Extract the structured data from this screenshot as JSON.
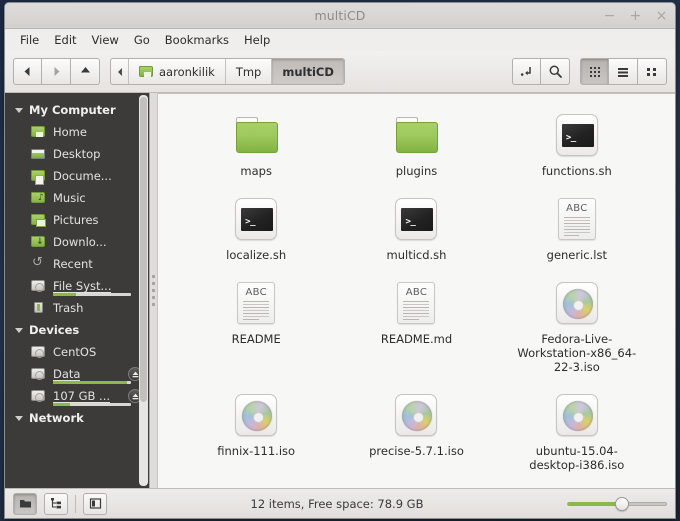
{
  "window": {
    "title": "multiCD",
    "controls": {
      "minimize": "−",
      "maximize": "+",
      "close": "×"
    }
  },
  "menubar": {
    "items": [
      {
        "label": "File"
      },
      {
        "label": "Edit"
      },
      {
        "label": "View"
      },
      {
        "label": "Go"
      },
      {
        "label": "Bookmarks"
      },
      {
        "label": "Help"
      }
    ]
  },
  "toolbar": {
    "nav": [
      {
        "name": "back-button",
        "icon": "arrow-left-icon",
        "enabled": true
      },
      {
        "name": "forward-button",
        "icon": "arrow-right-icon",
        "enabled": false
      },
      {
        "name": "up-button",
        "icon": "arrow-up-icon",
        "enabled": true
      }
    ],
    "breadcrumbs": [
      {
        "label": "aaronkilik",
        "icon": "home-folder-icon",
        "active": false
      },
      {
        "label": "Tmp",
        "icon": "",
        "active": false
      },
      {
        "label": "multiCD",
        "icon": "",
        "active": true
      }
    ],
    "actions": [
      {
        "name": "show-hidden-button",
        "icon": "path-entry-icon"
      },
      {
        "name": "search-button",
        "icon": "search-icon"
      }
    ],
    "view_modes": [
      {
        "name": "icon-view-button",
        "icon": "grid-icon",
        "active": true
      },
      {
        "name": "list-view-button",
        "icon": "list-icon",
        "active": false
      },
      {
        "name": "compact-view-button",
        "icon": "compact-icon",
        "active": false
      }
    ]
  },
  "sidebar": {
    "groups": [
      {
        "label": "My Computer",
        "items": [
          {
            "label": "Home",
            "icon": "home-folder-icon",
            "usage": null,
            "eject": false,
            "underline": false
          },
          {
            "label": "Desktop",
            "icon": "desktop-folder-icon",
            "usage": null,
            "eject": false,
            "underline": false
          },
          {
            "label": "Docume...",
            "icon": "documents-folder-icon",
            "usage": null,
            "eject": false,
            "underline": false
          },
          {
            "label": "Music",
            "icon": "music-folder-icon",
            "usage": null,
            "eject": false,
            "underline": false
          },
          {
            "label": "Pictures",
            "icon": "pictures-folder-icon",
            "usage": null,
            "eject": false,
            "underline": false
          },
          {
            "label": "Downlo...",
            "icon": "downloads-folder-icon",
            "usage": null,
            "eject": false,
            "underline": false
          },
          {
            "label": "Recent",
            "icon": "recent-icon",
            "usage": null,
            "eject": false,
            "underline": false
          },
          {
            "label": "File Syst...",
            "icon": "drive-icon",
            "usage": 30,
            "eject": false,
            "underline": true
          },
          {
            "label": "Trash",
            "icon": "trash-icon",
            "usage": null,
            "eject": false,
            "underline": false
          }
        ]
      },
      {
        "label": "Devices",
        "items": [
          {
            "label": "CentOS",
            "icon": "drive-icon",
            "usage": null,
            "eject": false,
            "underline": false
          },
          {
            "label": "Data",
            "icon": "drive-icon",
            "usage": 95,
            "eject": true,
            "underline": true
          },
          {
            "label": "107 GB ...",
            "icon": "drive-icon",
            "usage": 22,
            "eject": true,
            "underline": true
          }
        ]
      },
      {
        "label": "Network",
        "items": []
      }
    ]
  },
  "content": {
    "files": [
      {
        "name": "maps",
        "type": "folder"
      },
      {
        "name": "plugins",
        "type": "folder"
      },
      {
        "name": "functions.sh",
        "type": "script"
      },
      {
        "name": "localize.sh",
        "type": "script"
      },
      {
        "name": "multicd.sh",
        "type": "script"
      },
      {
        "name": "generic.lst",
        "type": "text"
      },
      {
        "name": "README",
        "type": "text"
      },
      {
        "name": "README.md",
        "type": "text"
      },
      {
        "name": "Fedora-Live-Workstation-x86_64-22-3.iso",
        "type": "iso"
      },
      {
        "name": "finnix-111.iso",
        "type": "iso"
      },
      {
        "name": "precise-5.7.1.iso",
        "type": "iso"
      },
      {
        "name": "ubuntu-15.04-desktop-i386.iso",
        "type": "iso"
      }
    ]
  },
  "statusbar": {
    "buttons": [
      {
        "name": "folder-pane-button",
        "icon": "open-folder-icon",
        "active": true
      },
      {
        "name": "tree-pane-button",
        "icon": "tree-icon",
        "active": false
      },
      {
        "name": "toggle-sidebar-button",
        "icon": "sidebar-toggle-icon",
        "active": false
      }
    ],
    "text": "12 items, Free space: 78.9 GB",
    "zoom_slider": {
      "name": "zoom-slider",
      "value": 55
    }
  },
  "colors": {
    "accent_green": "#8cb84a",
    "sidebar_bg": "#3c3b39",
    "window_bg": "#f0eeed",
    "content_bg": "#f7f7f6"
  }
}
